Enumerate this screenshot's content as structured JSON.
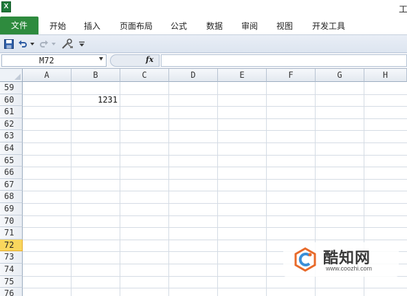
{
  "window": {
    "title_partial": "工"
  },
  "ribbon": {
    "file_tab": "文件",
    "tabs": [
      "开始",
      "插入",
      "页面布局",
      "公式",
      "数据",
      "审阅",
      "视图",
      "开发工具"
    ]
  },
  "quick_access": {
    "items": [
      {
        "name": "save-icon"
      },
      {
        "name": "undo-icon"
      },
      {
        "name": "redo-icon"
      },
      {
        "name": "customize-icon"
      }
    ]
  },
  "formula_bar": {
    "name_box": "M72",
    "fx_label": "fx",
    "formula": ""
  },
  "sheet": {
    "columns": [
      "A",
      "B",
      "C",
      "D",
      "E",
      "F",
      "G",
      "H"
    ],
    "rows": [
      "59",
      "60",
      "61",
      "62",
      "63",
      "64",
      "65",
      "66",
      "67",
      "68",
      "69",
      "70",
      "71",
      "72",
      "73",
      "74",
      "75",
      "76"
    ],
    "selected_row": "72",
    "cell_B60": "1231"
  },
  "watermark": {
    "name": "酷知网",
    "url": "www.coozhi.com"
  },
  "colors": {
    "file_tab": "#2e8b3e",
    "selected_row_header": "#f9d65d",
    "gridline": "#d4dbe4"
  }
}
